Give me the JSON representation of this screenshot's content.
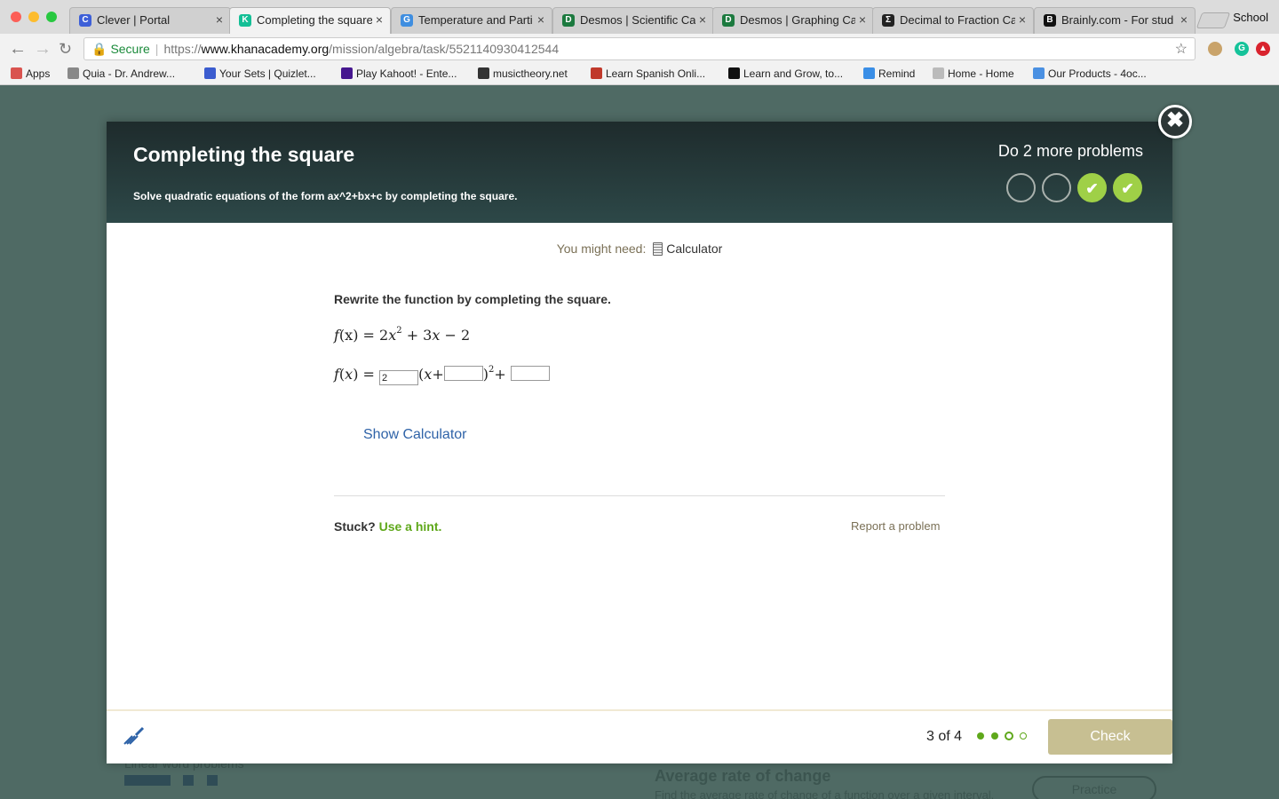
{
  "browser": {
    "tabs": [
      {
        "title": "Clever | Portal",
        "favicon": "C",
        "color": "#3d5fd8"
      },
      {
        "title": "Completing the square",
        "favicon": "K",
        "color": "#14bf96"
      },
      {
        "title": "Temperature and Parti",
        "favicon": "G",
        "color": "#3f8ee0"
      },
      {
        "title": "Desmos | Scientific Ca",
        "favicon": "D",
        "color": "#1c7a3f"
      },
      {
        "title": "Desmos | Graphing Ca",
        "favicon": "D",
        "color": "#1c7a3f"
      },
      {
        "title": "Decimal to Fraction Ca",
        "favicon": "Σ",
        "color": "#222222"
      },
      {
        "title": "Brainly.com - For stud",
        "favicon": "B",
        "color": "#111111"
      }
    ],
    "profile": "School",
    "url": {
      "secure": "Secure",
      "protocol": "https://",
      "host": "www.khanacademy.org",
      "path": "/mission/algebra/task/5521140930412544"
    },
    "bookmarks": [
      {
        "label": "Apps",
        "color": "#d9534f"
      },
      {
        "label": "Quia - Dr. Andrew...",
        "color": "#888888"
      },
      {
        "label": "Your Sets | Quizlet...",
        "color": "#3b5ccf"
      },
      {
        "label": "Play Kahoot! - Ente...",
        "color": "#46178f"
      },
      {
        "label": "musictheory.net",
        "color": "#333333"
      },
      {
        "label": "Learn Spanish Onli...",
        "color": "#c0392b"
      },
      {
        "label": "Learn and Grow, to...",
        "color": "#111111"
      },
      {
        "label": "Remind",
        "color": "#3a8ee6"
      },
      {
        "label": "Home - Home",
        "color": "#bbbbbb"
      },
      {
        "label": "Our Products - 4oc...",
        "color": "#4a90e2"
      }
    ]
  },
  "background_page": {
    "left_label": "Linear word problems",
    "card_title": "Average rate of change",
    "card_desc": "Find the average rate of change of a function over a given interval.",
    "practice": "Practice"
  },
  "modal": {
    "title": "Completing the square",
    "subtitle": "Solve quadratic equations of the form ax^2+bx+c by completing the square.",
    "remaining": "Do 2 more problems",
    "progress_circles": [
      "empty",
      "empty",
      "done",
      "done"
    ],
    "need_prefix": "You might need:",
    "need_tool": "Calculator",
    "prompt": "Rewrite the function by completing the square.",
    "equation": {
      "f": "f",
      "x": "x",
      "lhs_rest": "(x) = 2",
      "term1": "+ 3",
      "term2": "− 2",
      "exp": "2"
    },
    "answer": {
      "box1_value": "2",
      "box2_value": "",
      "box3_value": ""
    },
    "show_calculator": "Show Calculator",
    "stuck": "Stuck?",
    "hint": "Use a hint.",
    "report": "Report a problem",
    "progress_text": "3 of 4",
    "dots": [
      "filled",
      "filled",
      "current",
      "empty"
    ],
    "check": "Check",
    "close_glyph": "✖",
    "check_glyph": "✔"
  },
  "colors": {
    "accent_green": "#9fd047",
    "link_blue": "#2f63a8",
    "hint_green": "#5fa81b",
    "check_button": "#c7bf92"
  }
}
